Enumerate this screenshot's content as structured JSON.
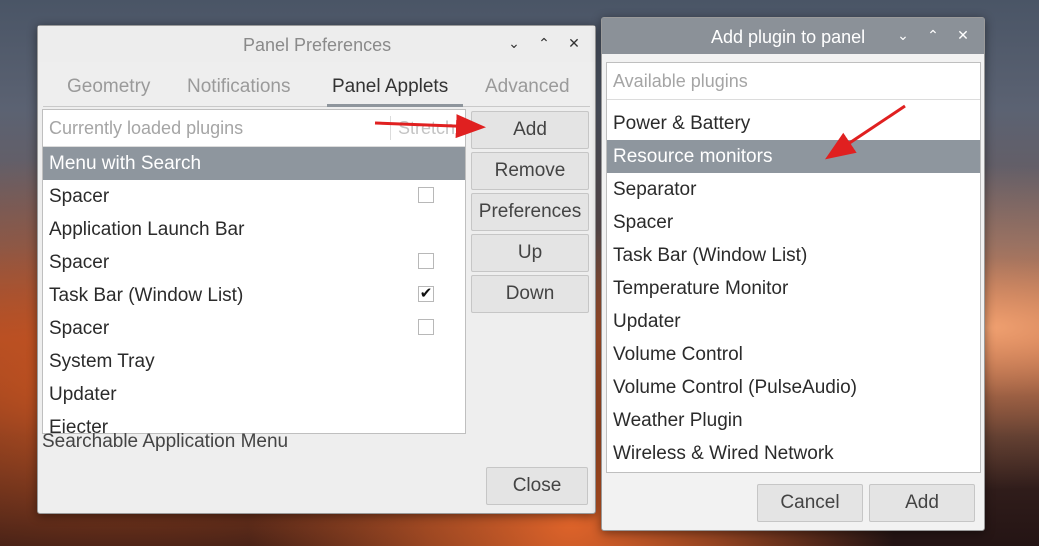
{
  "panel_prefs": {
    "title": "Panel Preferences",
    "tabs": [
      "Geometry",
      "Notifications",
      "Panel Applets",
      "Advanced"
    ],
    "active_tab": "Panel Applets",
    "list_header": "Currently loaded plugins",
    "list_header_col": "Stretch",
    "items": [
      {
        "label": "Menu with Search",
        "selected": true
      },
      {
        "label": "Spacer",
        "checkbox": false
      },
      {
        "label": "Application Launch Bar"
      },
      {
        "label": "Spacer",
        "checkbox": false
      },
      {
        "label": "Task Bar (Window List)",
        "checkbox": true
      },
      {
        "label": "Spacer",
        "checkbox": false
      },
      {
        "label": "System Tray"
      },
      {
        "label": "Updater"
      },
      {
        "label": "Ejecter"
      }
    ],
    "buttons": {
      "add": "Add",
      "remove": "Remove",
      "preferences": "Preferences",
      "up": "Up",
      "down": "Down"
    },
    "description": "Searchable Application Menu",
    "close_label": "Close"
  },
  "add_plugin": {
    "title": "Add plugin to panel",
    "list_header": "Available plugins",
    "items": [
      {
        "label": "Power & Battery"
      },
      {
        "label": "Resource monitors",
        "selected": true
      },
      {
        "label": "Separator"
      },
      {
        "label": "Spacer"
      },
      {
        "label": "Task Bar (Window List)"
      },
      {
        "label": "Temperature Monitor"
      },
      {
        "label": "Updater"
      },
      {
        "label": "Volume Control"
      },
      {
        "label": "Volume Control (PulseAudio)"
      },
      {
        "label": "Weather Plugin"
      },
      {
        "label": "Wireless & Wired Network"
      }
    ],
    "cancel_label": "Cancel",
    "add_label": "Add"
  },
  "colors": {
    "selection": "#8e969e",
    "arrow": "#e02020"
  },
  "icons": {
    "minimize": "chevron-down-icon",
    "maximize": "chevron-up-icon",
    "close": "close-icon",
    "checkmark": "checkmark-icon"
  }
}
